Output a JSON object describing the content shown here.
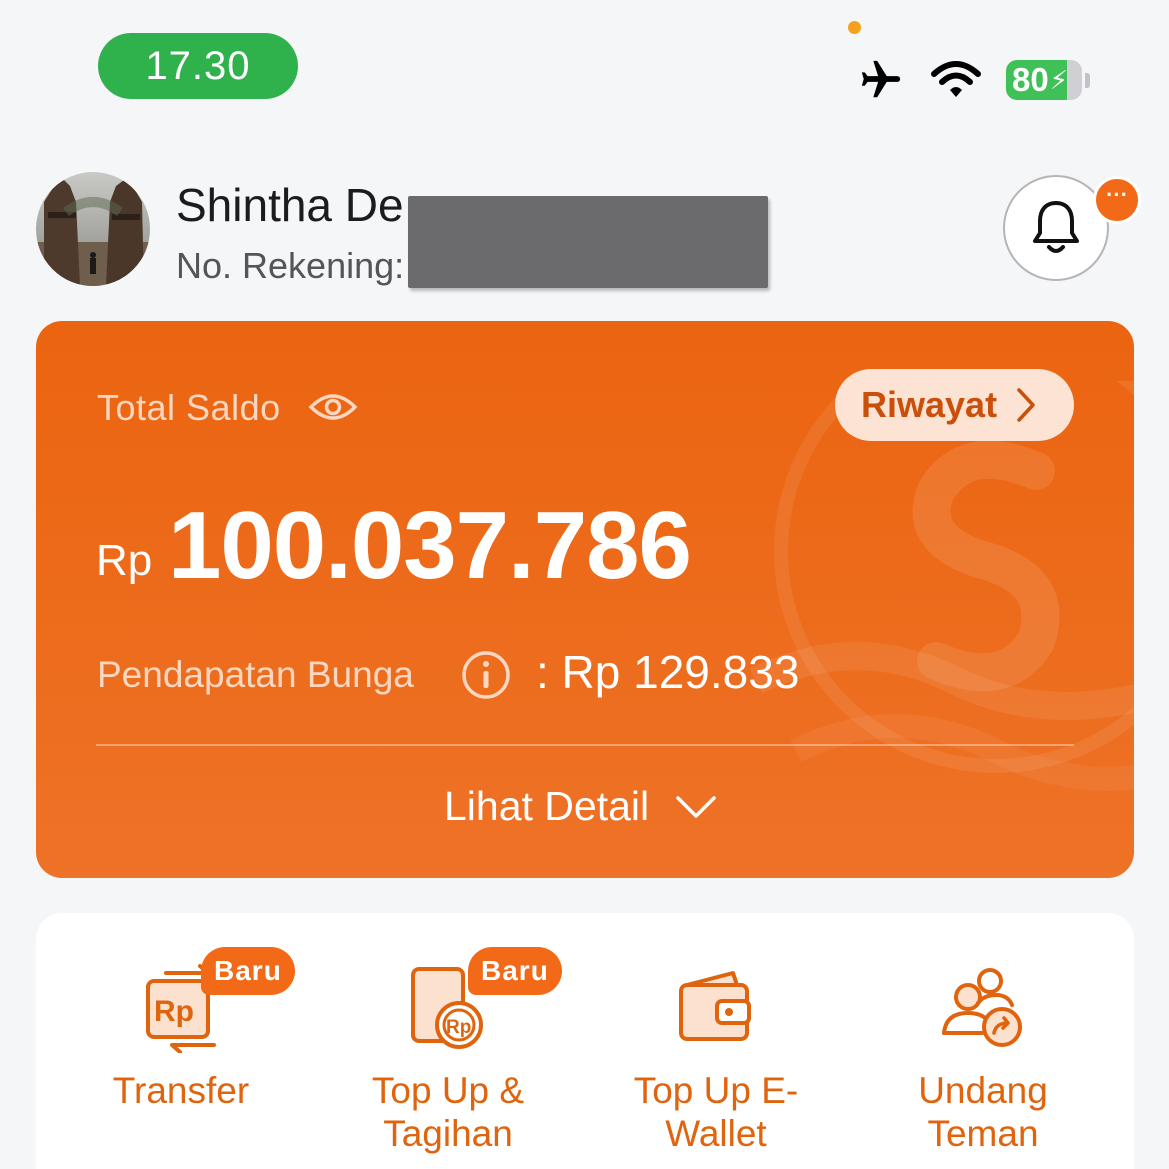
{
  "status_bar": {
    "time": "17.30",
    "battery_level": "80",
    "battery_fraction": 0.8,
    "icons": [
      "airplane-icon",
      "wifi-icon",
      "battery-charging-icon"
    ]
  },
  "profile": {
    "name": "Shintha De",
    "account_label": "No. Rekening:",
    "notification_badge": "···"
  },
  "balance": {
    "label": "Total Saldo",
    "history_button": "Riwayat",
    "currency": "Rp",
    "amount": "100.037.786",
    "interest_label": "Pendapatan Bunga",
    "interest_value": ": Rp 129.833",
    "detail_link": "Lihat Detail"
  },
  "actions": [
    {
      "label_line1": "Transfer",
      "label_line2": "",
      "badge": "Baru",
      "icon": "transfer-rp-icon"
    },
    {
      "label_line1": "Top Up &",
      "label_line2": "Tagihan",
      "badge": "Baru",
      "icon": "topup-bill-icon"
    },
    {
      "label_line1": "Top Up E-",
      "label_line2": "Wallet",
      "badge": "",
      "icon": "wallet-icon"
    },
    {
      "label_line1": "Undang",
      "label_line2": "Teman",
      "badge": "",
      "icon": "invite-friends-icon"
    }
  ],
  "colors": {
    "brand_orange": "#eb6410",
    "status_green": "#2fb24c",
    "background": "#f5f6f8"
  }
}
